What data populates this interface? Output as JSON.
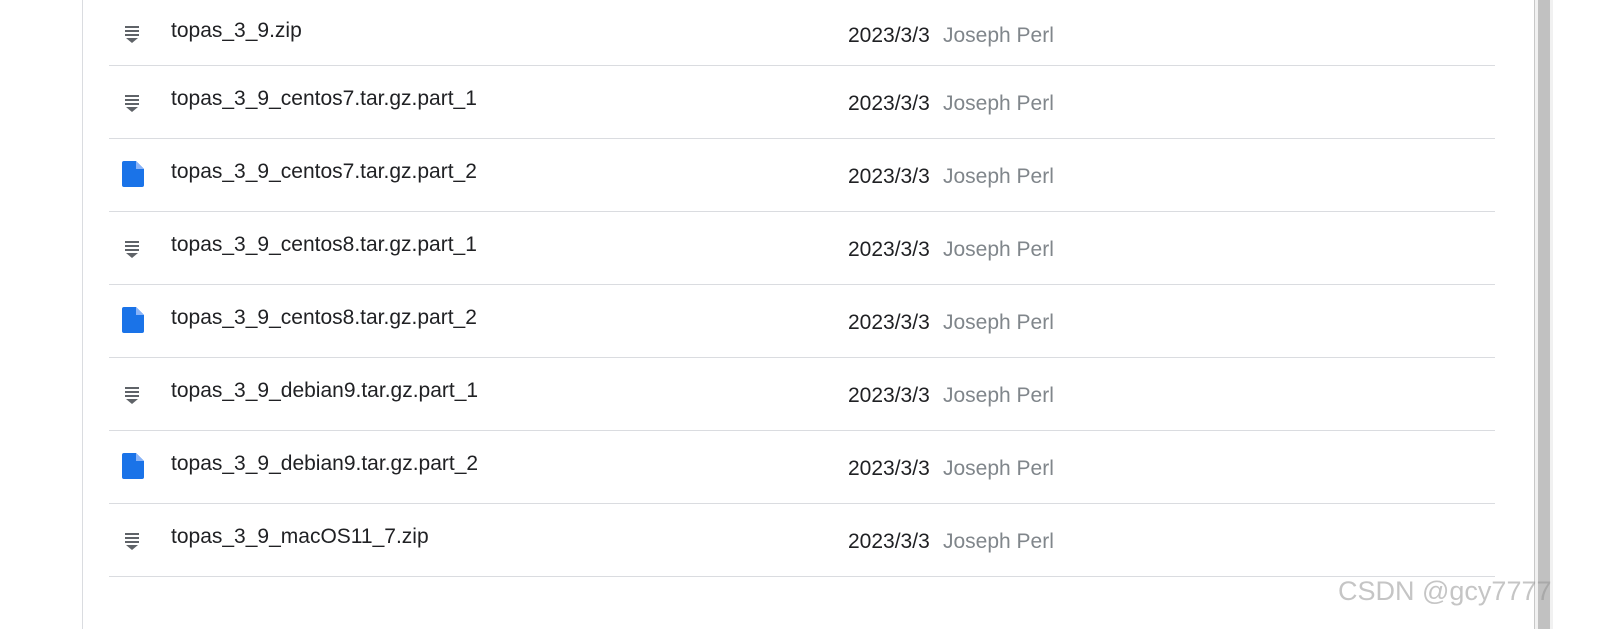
{
  "files": [
    {
      "name": "topas_3_9.zip",
      "date": "2023/3/3",
      "owner": "Joseph Perl",
      "icon": "zip-icon"
    },
    {
      "name": "topas_3_9_centos7.tar.gz.part_1",
      "date": "2023/3/3",
      "owner": "Joseph Perl",
      "icon": "zip-icon"
    },
    {
      "name": "topas_3_9_centos7.tar.gz.part_2",
      "date": "2023/3/3",
      "owner": "Joseph Perl",
      "icon": "file-icon"
    },
    {
      "name": "topas_3_9_centos8.tar.gz.part_1",
      "date": "2023/3/3",
      "owner": "Joseph Perl",
      "icon": "zip-icon"
    },
    {
      "name": "topas_3_9_centos8.tar.gz.part_2",
      "date": "2023/3/3",
      "owner": "Joseph Perl",
      "icon": "file-icon"
    },
    {
      "name": "topas_3_9_debian9.tar.gz.part_1",
      "date": "2023/3/3",
      "owner": "Joseph Perl",
      "icon": "zip-icon"
    },
    {
      "name": "topas_3_9_debian9.tar.gz.part_2",
      "date": "2023/3/3",
      "owner": "Joseph Perl",
      "icon": "file-icon"
    },
    {
      "name": "topas_3_9_macOS11_7.zip",
      "date": "2023/3/3",
      "owner": "Joseph Perl",
      "icon": "zip-icon"
    }
  ],
  "colors": {
    "file_icon": "#1a73e8",
    "zip_icon": "#5f6368",
    "owner_text": "#80868b"
  },
  "watermark": "CSDN @gcy7777"
}
